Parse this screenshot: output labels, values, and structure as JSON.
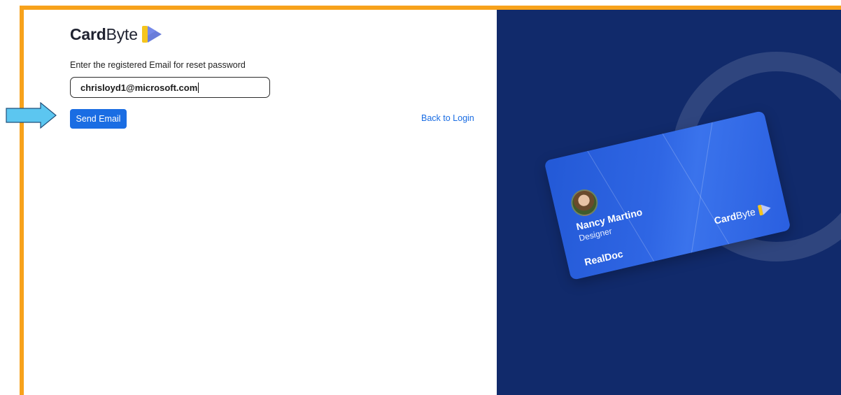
{
  "brand": {
    "logo_part1": "Card",
    "logo_part2": "Byte"
  },
  "form": {
    "prompt": "Enter the registered Email for reset password",
    "email_value": "chrisloyd1@microsoft.com",
    "send_label": "Send Email",
    "back_label": "Back to Login"
  },
  "card": {
    "name": "Nancy Martino",
    "role": "Designer",
    "company": "RealDoc",
    "logo_part1": "Card",
    "logo_part2": "Byte"
  },
  "colors": {
    "frame": "#f7a21b",
    "accent": "#1a6de3",
    "panel_bg": "#112a6b",
    "card_bg": "#2f66e4",
    "arrow": "#5cc6f0"
  }
}
